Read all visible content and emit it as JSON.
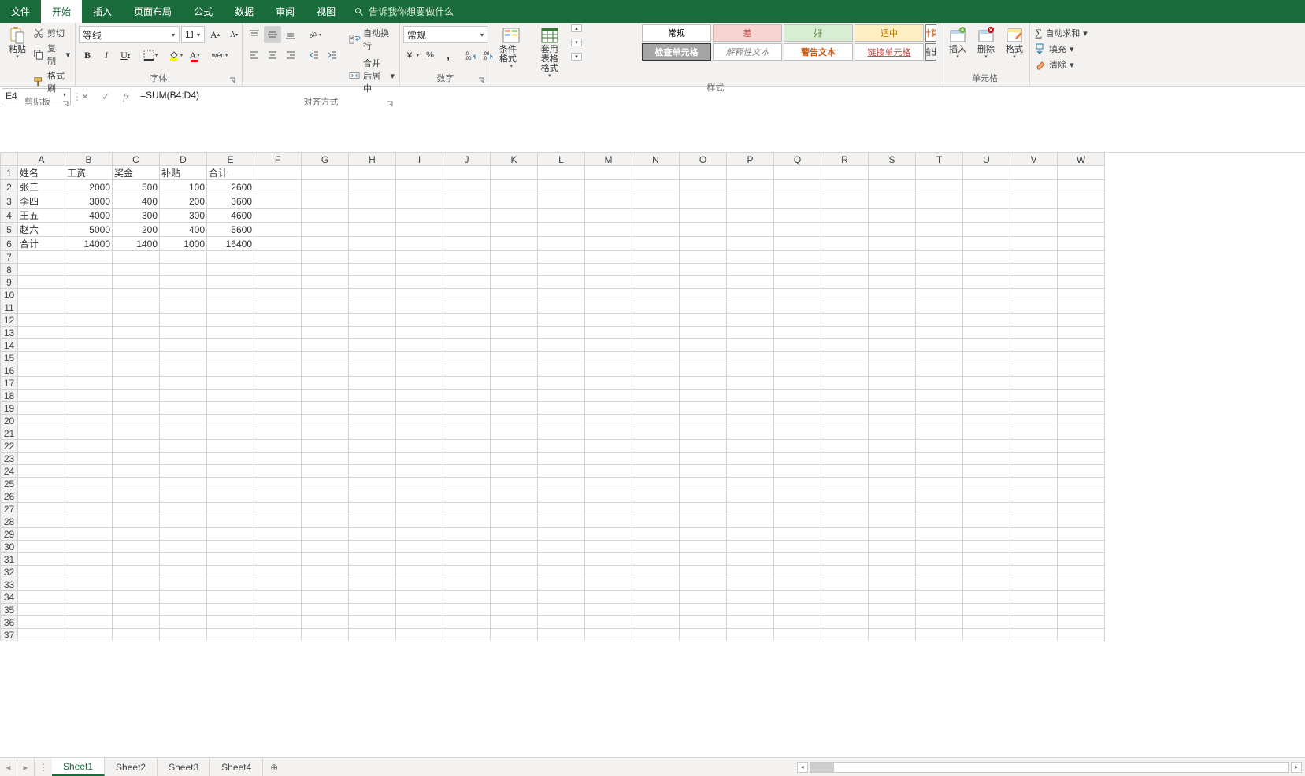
{
  "tabs": {
    "file": "文件",
    "home": "开始",
    "insert": "插入",
    "layout": "页面布局",
    "formulas": "公式",
    "data": "数据",
    "review": "审阅",
    "view": "视图",
    "tell_me": "告诉我你想要做什么"
  },
  "ribbon": {
    "clipboard": {
      "label": "剪贴板",
      "paste": "粘贴",
      "cut": "剪切",
      "copy": "复制",
      "format_painter": "格式刷"
    },
    "font": {
      "label": "字体",
      "name": "等线",
      "size": "11"
    },
    "alignment": {
      "label": "对齐方式",
      "wrap": "自动换行",
      "merge": "合并后居中"
    },
    "number": {
      "label": "数字",
      "format": "常规"
    },
    "cond": {
      "cond": "条件格式",
      "table": "套用\n表格格式"
    },
    "styles": {
      "label": "样式",
      "cells": [
        {
          "t": "常规",
          "c": "sc-normal"
        },
        {
          "t": "差",
          "c": "sc-bad"
        },
        {
          "t": "好",
          "c": "sc-good"
        },
        {
          "t": "适中",
          "c": "sc-neutral"
        },
        {
          "t": "计算",
          "c": "sc-calc"
        },
        {
          "t": "检查单元格",
          "c": "sc-check"
        },
        {
          "t": "解释性文本",
          "c": "sc-expl"
        },
        {
          "t": "警告文本",
          "c": "sc-warn"
        },
        {
          "t": "链接单元格",
          "c": "sc-link"
        },
        {
          "t": "输出",
          "c": "sc-out"
        }
      ]
    },
    "cells_group": {
      "label": "单元格",
      "insert": "插入",
      "delete": "删除",
      "format": "格式"
    },
    "editing": {
      "autosum": "自动求和",
      "fill": "填充",
      "clear": "清除"
    }
  },
  "name_box": "E4",
  "formula": "=SUM(B4:D4)",
  "columns": [
    "A",
    "B",
    "C",
    "D",
    "E",
    "F",
    "G",
    "H",
    "I",
    "J",
    "K",
    "L",
    "M",
    "N",
    "O",
    "P",
    "Q",
    "R",
    "S",
    "T",
    "U",
    "V",
    "W"
  ],
  "row_count": 37,
  "data_rows": [
    {
      "r": 1,
      "cells": {
        "A": {
          "v": "姓名",
          "t": "txt"
        },
        "B": {
          "v": "工资",
          "t": "txt"
        },
        "C": {
          "v": "奖金",
          "t": "txt"
        },
        "D": {
          "v": "补贴",
          "t": "txt"
        },
        "E": {
          "v": "合计",
          "t": "txt"
        }
      }
    },
    {
      "r": 2,
      "cells": {
        "A": {
          "v": "张三",
          "t": "txt"
        },
        "B": {
          "v": "2000",
          "t": "num"
        },
        "C": {
          "v": "500",
          "t": "num"
        },
        "D": {
          "v": "100",
          "t": "num"
        },
        "E": {
          "v": "2600",
          "t": "num"
        }
      }
    },
    {
      "r": 3,
      "cells": {
        "A": {
          "v": "李四",
          "t": "txt"
        },
        "B": {
          "v": "3000",
          "t": "num"
        },
        "C": {
          "v": "400",
          "t": "num"
        },
        "D": {
          "v": "200",
          "t": "num"
        },
        "E": {
          "v": "3600",
          "t": "num"
        }
      }
    },
    {
      "r": 4,
      "cells": {
        "A": {
          "v": "王五",
          "t": "txt"
        },
        "B": {
          "v": "4000",
          "t": "num"
        },
        "C": {
          "v": "300",
          "t": "num"
        },
        "D": {
          "v": "300",
          "t": "num"
        },
        "E": {
          "v": "4600",
          "t": "num"
        }
      }
    },
    {
      "r": 5,
      "cells": {
        "A": {
          "v": "赵六",
          "t": "txt"
        },
        "B": {
          "v": "5000",
          "t": "num"
        },
        "C": {
          "v": "200",
          "t": "num"
        },
        "D": {
          "v": "400",
          "t": "num"
        },
        "E": {
          "v": "5600",
          "t": "num"
        }
      }
    },
    {
      "r": 6,
      "cells": {
        "A": {
          "v": "合计",
          "t": "txt"
        },
        "B": {
          "v": "14000",
          "t": "num"
        },
        "C": {
          "v": "1400",
          "t": "num"
        },
        "D": {
          "v": "1000",
          "t": "num"
        },
        "E": {
          "v": "16400",
          "t": "num"
        }
      }
    }
  ],
  "sheet_tabs": [
    "Sheet1",
    "Sheet2",
    "Sheet3",
    "Sheet4"
  ],
  "active_sheet": 0
}
